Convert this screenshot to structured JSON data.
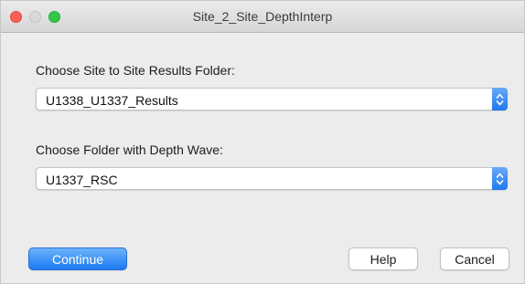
{
  "window": {
    "title": "Site_2_Site_DepthInterp"
  },
  "form": {
    "results_folder": {
      "label": "Choose Site to Site Results Folder:",
      "value": "U1338_U1337_Results"
    },
    "depth_folder": {
      "label": "Choose Folder with Depth Wave:",
      "value": "U1337_RSC"
    }
  },
  "buttons": {
    "continue_label": "Continue",
    "help_label": "Help",
    "cancel_label": "Cancel"
  },
  "colors": {
    "accent": "#1b79f2",
    "close": "#fc5f57",
    "maximize": "#33c748"
  }
}
